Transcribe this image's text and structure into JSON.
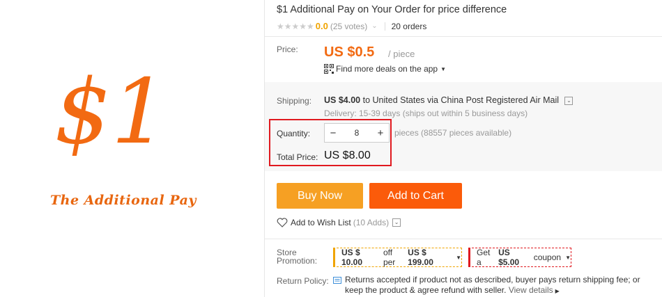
{
  "left_banner": {
    "big_text": "$1",
    "tagline": "The Additional Pay"
  },
  "product": {
    "title": "$1 Additional Pay on Your Order for price difference",
    "rating_score": "0.0",
    "votes": "(25 votes)",
    "orders": "20 orders"
  },
  "price": {
    "label": "Price:",
    "value": "US $0.5",
    "unit": "/ piece",
    "app_deals": "Find more deals on the app"
  },
  "shipping": {
    "label": "Shipping:",
    "amount": "US $4.00",
    "text": "to United States via China Post Registered Air Mail",
    "delivery": "Delivery: 15-39 days (ships out within 5 business days)"
  },
  "quantity": {
    "label": "Quantity:",
    "value": "8",
    "available": "pieces (88557 pieces available)"
  },
  "total": {
    "label": "Total Price:",
    "value": "US $8.00"
  },
  "buttons": {
    "buy_now": "Buy Now",
    "add_to_cart": "Add to Cart"
  },
  "wishlist": {
    "label": "Add to Wish List",
    "adds": "(10 Adds)"
  },
  "store_promotion": {
    "label_line1": "Store",
    "label_line2": "Promotion:",
    "coupon1_amount": "US $ 10.00",
    "coupon1_mid": "off per",
    "coupon1_threshold": "US $ 199.00",
    "coupon2_prefix": "Get a",
    "coupon2_amount": "US $5.00",
    "coupon2_suffix": "coupon"
  },
  "return_policy": {
    "label": "Return Policy:",
    "text": "Returns accepted if product not as described, buyer pays return shipping fee; or keep the product & agree refund with seller.",
    "details": "View details"
  },
  "colors": {
    "accent_orange": "#f26a12",
    "buy_button": "#f6a023",
    "cart_button": "#fb5b0a",
    "highlight_red": "#e0191f",
    "rating_gold": "#f0a400"
  },
  "icons": [
    "star-icon",
    "chevron-down-icon",
    "qr-code-icon",
    "minus-icon",
    "plus-icon",
    "heart-icon",
    "return-icon",
    "triangle-right-icon"
  ]
}
